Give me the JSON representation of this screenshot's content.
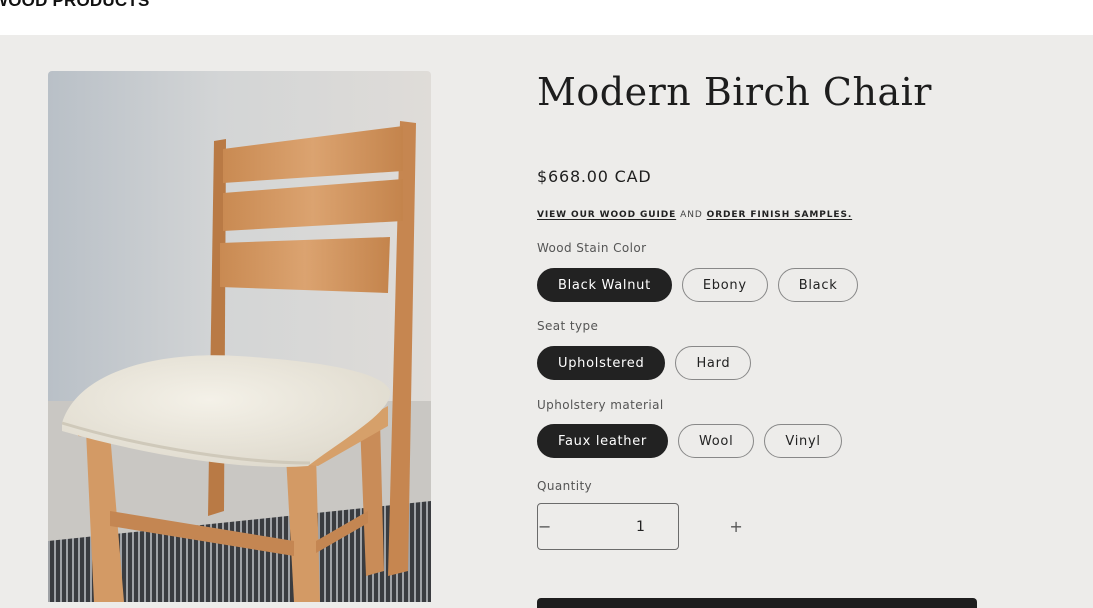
{
  "header": {
    "brand": "WOOD PRODUCTS"
  },
  "product": {
    "title": "Modern Birch Chair",
    "price": "$668.00 CAD",
    "image_alt": "Modern Birch Chair with upholstered seat",
    "guide": {
      "link1": "VIEW OUR WOOD GUIDE",
      "and": "AND",
      "link2": "ORDER FINISH SAMPLES."
    }
  },
  "options": {
    "stain": {
      "label": "Wood Stain Color",
      "values": [
        "Black Walnut",
        "Ebony",
        "Black"
      ],
      "selected": "Black Walnut"
    },
    "seat": {
      "label": "Seat type",
      "values": [
        "Upholstered",
        "Hard"
      ],
      "selected": "Upholstered"
    },
    "upholstery": {
      "label": "Upholstery material",
      "values": [
        "Faux leather",
        "Wool",
        "Vinyl"
      ],
      "selected": "Faux leather"
    }
  },
  "quantity": {
    "label": "Quantity",
    "value": "1",
    "decrease": "−",
    "increase": "+"
  },
  "colors": {
    "selected_pill": "#222222",
    "page_bg": "#edecea"
  }
}
